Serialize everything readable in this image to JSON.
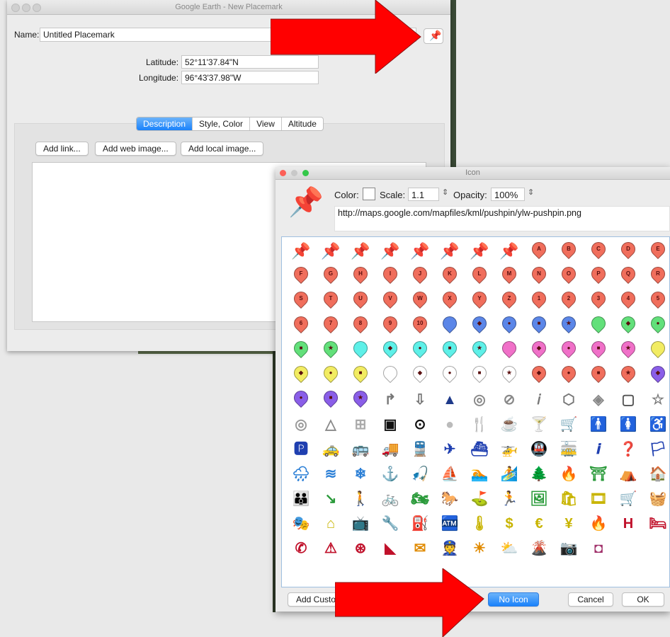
{
  "main_window": {
    "title": "Google Earth - New Placemark",
    "name_label": "Name:",
    "name_value": "Untitled Placemark",
    "latitude_label": "Latitude:",
    "latitude_value": "52°11'37.84\"N",
    "longitude_label": "Longitude:",
    "longitude_value": "96°43'37.98\"W",
    "tabs": [
      "Description",
      "Style, Color",
      "View",
      "Altitude"
    ],
    "add_link": "Add link...",
    "add_web_image": "Add web image...",
    "add_local_image": "Add local image..."
  },
  "icon_window": {
    "title": "Icon",
    "color_label": "Color:",
    "scale_label": "Scale:",
    "scale_value": "1.1",
    "opacity_label": "Opacity:",
    "opacity_value": "100%",
    "url": "http://maps.google.com/mapfiles/kml/pushpin/ylw-pushpin.png",
    "add_custom": "Add Custo",
    "no_icon": "No Icon",
    "cancel": "Cancel",
    "ok": "OK",
    "icons": [
      {
        "k": "tack",
        "c": "#f2e33a"
      },
      {
        "k": "tack",
        "c": "#3c5fd6"
      },
      {
        "k": "tack",
        "c": "#2fc234"
      },
      {
        "k": "tack",
        "c": "#35c6c6"
      },
      {
        "k": "tack",
        "c": "#d438c6"
      },
      {
        "k": "tack",
        "c": "#6b3fd6"
      },
      {
        "k": "tack",
        "c": "#e03a4a"
      },
      {
        "k": "tack",
        "c": "#e9e9e9"
      },
      {
        "k": "pin",
        "c": "#f06e5c",
        "t": "A"
      },
      {
        "k": "pin",
        "c": "#f06e5c",
        "t": "B"
      },
      {
        "k": "pin",
        "c": "#f06e5c",
        "t": "C"
      },
      {
        "k": "pin",
        "c": "#f06e5c",
        "t": "D"
      },
      {
        "k": "pin",
        "c": "#f06e5c",
        "t": "E"
      },
      {
        "k": "pin",
        "c": "#f06e5c",
        "t": "F"
      },
      {
        "k": "pin",
        "c": "#f06e5c",
        "t": "G"
      },
      {
        "k": "pin",
        "c": "#f06e5c",
        "t": "H"
      },
      {
        "k": "pin",
        "c": "#f06e5c",
        "t": "I"
      },
      {
        "k": "pin",
        "c": "#f06e5c",
        "t": "J"
      },
      {
        "k": "pin",
        "c": "#f06e5c",
        "t": "K"
      },
      {
        "k": "pin",
        "c": "#f06e5c",
        "t": "L"
      },
      {
        "k": "pin",
        "c": "#f06e5c",
        "t": "M"
      },
      {
        "k": "pin",
        "c": "#f06e5c",
        "t": "N"
      },
      {
        "k": "pin",
        "c": "#f06e5c",
        "t": "O"
      },
      {
        "k": "pin",
        "c": "#f06e5c",
        "t": "P"
      },
      {
        "k": "pin",
        "c": "#f06e5c",
        "t": "Q"
      },
      {
        "k": "pin",
        "c": "#f06e5c",
        "t": "R"
      },
      {
        "k": "pin",
        "c": "#f06e5c",
        "t": "S"
      },
      {
        "k": "pin",
        "c": "#f06e5c",
        "t": "T"
      },
      {
        "k": "pin",
        "c": "#f06e5c",
        "t": "U"
      },
      {
        "k": "pin",
        "c": "#f06e5c",
        "t": "V"
      },
      {
        "k": "pin",
        "c": "#f06e5c",
        "t": "W"
      },
      {
        "k": "pin",
        "c": "#f06e5c",
        "t": "X"
      },
      {
        "k": "pin",
        "c": "#f06e5c",
        "t": "Y"
      },
      {
        "k": "pin",
        "c": "#f06e5c",
        "t": "Z"
      },
      {
        "k": "pin",
        "c": "#f06e5c",
        "t": "1"
      },
      {
        "k": "pin",
        "c": "#f06e5c",
        "t": "2"
      },
      {
        "k": "pin",
        "c": "#f06e5c",
        "t": "3"
      },
      {
        "k": "pin",
        "c": "#f06e5c",
        "t": "4"
      },
      {
        "k": "pin",
        "c": "#f06e5c",
        "t": "5"
      },
      {
        "k": "pin",
        "c": "#f06e5c",
        "t": "6"
      },
      {
        "k": "pin",
        "c": "#f06e5c",
        "t": "7"
      },
      {
        "k": "pin",
        "c": "#f06e5c",
        "t": "8"
      },
      {
        "k": "pin",
        "c": "#f06e5c",
        "t": "9"
      },
      {
        "k": "pin",
        "c": "#f06e5c",
        "t": "10"
      },
      {
        "k": "pin",
        "c": "#5b86e8",
        "t": ""
      },
      {
        "k": "pin",
        "c": "#5b86e8",
        "t": "◆"
      },
      {
        "k": "pin",
        "c": "#5b86e8",
        "t": "●"
      },
      {
        "k": "pin",
        "c": "#5b86e8",
        "t": "■"
      },
      {
        "k": "pin",
        "c": "#5b86e8",
        "t": "★"
      },
      {
        "k": "pin",
        "c": "#62e07a",
        "t": ""
      },
      {
        "k": "pin",
        "c": "#62e07a",
        "t": "◆"
      },
      {
        "k": "pin",
        "c": "#62e07a",
        "t": "●"
      },
      {
        "k": "pin",
        "c": "#62e07a",
        "t": "■"
      },
      {
        "k": "pin",
        "c": "#62e07a",
        "t": "★"
      },
      {
        "k": "pin",
        "c": "#5ef0e8",
        "t": ""
      },
      {
        "k": "pin",
        "c": "#5ef0e8",
        "t": "◆"
      },
      {
        "k": "pin",
        "c": "#5ef0e8",
        "t": "●"
      },
      {
        "k": "pin",
        "c": "#5ef0e8",
        "t": "■"
      },
      {
        "k": "pin",
        "c": "#5ef0e8",
        "t": "★"
      },
      {
        "k": "pin",
        "c": "#f070c8",
        "t": ""
      },
      {
        "k": "pin",
        "c": "#f070c8",
        "t": "◆"
      },
      {
        "k": "pin",
        "c": "#f070c8",
        "t": "●"
      },
      {
        "k": "pin",
        "c": "#f070c8",
        "t": "■"
      },
      {
        "k": "pin",
        "c": "#f070c8",
        "t": "★"
      },
      {
        "k": "pin",
        "c": "#f2ec62",
        "t": ""
      },
      {
        "k": "pin",
        "c": "#f2ec62",
        "t": "◆"
      },
      {
        "k": "pin",
        "c": "#f2ec62",
        "t": "●"
      },
      {
        "k": "pin",
        "c": "#f2ec62",
        "t": "■"
      },
      {
        "k": "pin",
        "c": "#ffffff",
        "t": ""
      },
      {
        "k": "pin",
        "c": "#ffffff",
        "t": "◆"
      },
      {
        "k": "pin",
        "c": "#ffffff",
        "t": "●"
      },
      {
        "k": "pin",
        "c": "#ffffff",
        "t": "■"
      },
      {
        "k": "pin",
        "c": "#ffffff",
        "t": "★"
      },
      {
        "k": "pin",
        "c": "#f06e5c",
        "t": "◆"
      },
      {
        "k": "pin",
        "c": "#f06e5c",
        "t": "●"
      },
      {
        "k": "pin",
        "c": "#f06e5c",
        "t": "■"
      },
      {
        "k": "pin",
        "c": "#f06e5c",
        "t": "★"
      },
      {
        "k": "pin",
        "c": "#8a5ee8",
        "t": "◆"
      },
      {
        "k": "pin",
        "c": "#8a5ee8",
        "t": "●"
      },
      {
        "k": "pin",
        "c": "#8a5ee8",
        "t": "■"
      },
      {
        "k": "pin",
        "c": "#8a5ee8",
        "t": "★"
      },
      {
        "k": "sym",
        "g": "↱",
        "c": "#777"
      },
      {
        "k": "sym",
        "g": "⇩",
        "c": "#777"
      },
      {
        "k": "sym",
        "g": "▲",
        "c": "#1e3a8a"
      },
      {
        "k": "sym",
        "g": "◎",
        "c": "#888"
      },
      {
        "k": "sym",
        "g": "⊘",
        "c": "#888"
      },
      {
        "k": "sym",
        "g": "𝑖",
        "c": "#777"
      },
      {
        "k": "sym",
        "g": "⬡",
        "c": "#777"
      },
      {
        "k": "sym",
        "g": "◈",
        "c": "#888"
      },
      {
        "k": "sym",
        "g": "▢",
        "c": "#555"
      },
      {
        "k": "sym",
        "g": "☆",
        "c": "#777"
      },
      {
        "k": "sym",
        "g": "◎",
        "c": "#999"
      },
      {
        "k": "sym",
        "g": "△",
        "c": "#888"
      },
      {
        "k": "sym",
        "g": "⊞",
        "c": "#aaa"
      },
      {
        "k": "sym",
        "g": "▣",
        "c": "#111"
      },
      {
        "k": "sym",
        "g": "⊙",
        "c": "#111"
      },
      {
        "k": "sym",
        "g": "●",
        "c": "#bbb"
      },
      {
        "k": "sym",
        "g": "🍴",
        "c": "#222"
      },
      {
        "k": "sym",
        "g": "☕",
        "c": "#333"
      },
      {
        "k": "sym",
        "g": "🍸",
        "c": "#333"
      },
      {
        "k": "sym",
        "g": "🛒",
        "c": "#333"
      },
      {
        "k": "sym",
        "g": "🚹",
        "c": "#333"
      },
      {
        "k": "sym",
        "g": "🚺",
        "c": "#333"
      },
      {
        "k": "sym",
        "g": "♿",
        "c": "#222"
      },
      {
        "k": "sym",
        "g": "🅿",
        "c": "#1f3fb0"
      },
      {
        "k": "sym",
        "g": "🚕",
        "c": "#1f3fb0"
      },
      {
        "k": "sym",
        "g": "🚌",
        "c": "#1f3fb0"
      },
      {
        "k": "sym",
        "g": "🚚",
        "c": "#1f3fb0"
      },
      {
        "k": "sym",
        "g": "🚆",
        "c": "#1f3fb0"
      },
      {
        "k": "sym",
        "g": "✈",
        "c": "#1f3fb0"
      },
      {
        "k": "sym",
        "g": "⛴",
        "c": "#1f3fb0"
      },
      {
        "k": "sym",
        "g": "🚁",
        "c": "#1f3fb0"
      },
      {
        "k": "sym",
        "g": "🚇",
        "c": "#1f3fb0"
      },
      {
        "k": "sym",
        "g": "🚋",
        "c": "#1f3fb0"
      },
      {
        "k": "sym",
        "g": "𝒊",
        "c": "#1f3fb0"
      },
      {
        "k": "sym",
        "g": "❓",
        "c": "#1f3fb0"
      },
      {
        "k": "sym",
        "g": "🏳",
        "c": "#1f3fb0"
      },
      {
        "k": "sym",
        "g": "🌧",
        "c": "#2b7fd6"
      },
      {
        "k": "sym",
        "g": "≋",
        "c": "#2b7fd6"
      },
      {
        "k": "sym",
        "g": "❄",
        "c": "#2b7fd6"
      },
      {
        "k": "sym",
        "g": "⚓",
        "c": "#2b7fd6"
      },
      {
        "k": "sym",
        "g": "🎣",
        "c": "#2b7fd6"
      },
      {
        "k": "sym",
        "g": "⛵",
        "c": "#2b7fd6"
      },
      {
        "k": "sym",
        "g": "🏊",
        "c": "#2b7fd6"
      },
      {
        "k": "sym",
        "g": "🏄",
        "c": "#2b7fd6"
      },
      {
        "k": "sym",
        "g": "🌲",
        "c": "#2a9a3a"
      },
      {
        "k": "sym",
        "g": "🔥",
        "c": "#2a9a3a"
      },
      {
        "k": "sym",
        "g": "⛩",
        "c": "#2a9a3a"
      },
      {
        "k": "sym",
        "g": "⛺",
        "c": "#2a9a3a"
      },
      {
        "k": "sym",
        "g": "🏠",
        "c": "#2a9a3a"
      },
      {
        "k": "sym",
        "g": "👪",
        "c": "#2a9a3a"
      },
      {
        "k": "sym",
        "g": "↘",
        "c": "#2a9a3a"
      },
      {
        "k": "sym",
        "g": "🚶",
        "c": "#2a9a3a"
      },
      {
        "k": "sym",
        "g": "🚲",
        "c": "#2a9a3a"
      },
      {
        "k": "sym",
        "g": "🏍",
        "c": "#2a9a3a"
      },
      {
        "k": "sym",
        "g": "🐎",
        "c": "#2a9a3a"
      },
      {
        "k": "sym",
        "g": "⛳",
        "c": "#2a9a3a"
      },
      {
        "k": "sym",
        "g": "🏃",
        "c": "#2a9a3a"
      },
      {
        "k": "sym",
        "g": "🖼",
        "c": "#2a9a3a"
      },
      {
        "k": "sym",
        "g": "🛍",
        "c": "#c8b400"
      },
      {
        "k": "sym",
        "g": "🎞",
        "c": "#c8b400"
      },
      {
        "k": "sym",
        "g": "🛒",
        "c": "#c8b400"
      },
      {
        "k": "sym",
        "g": "🧺",
        "c": "#c8b400"
      },
      {
        "k": "sym",
        "g": "🎭",
        "c": "#c8b400"
      },
      {
        "k": "sym",
        "g": "⌂",
        "c": "#c8b400"
      },
      {
        "k": "sym",
        "g": "📺",
        "c": "#c8b400"
      },
      {
        "k": "sym",
        "g": "🔧",
        "c": "#c8b400"
      },
      {
        "k": "sym",
        "g": "⛽",
        "c": "#c8b400"
      },
      {
        "k": "sym",
        "g": "🏧",
        "c": "#c8b400"
      },
      {
        "k": "sym",
        "g": "🌡",
        "c": "#c8b400"
      },
      {
        "k": "sym",
        "g": "$",
        "c": "#c8b400"
      },
      {
        "k": "sym",
        "g": "€",
        "c": "#c8b400"
      },
      {
        "k": "sym",
        "g": "¥",
        "c": "#c8b400"
      },
      {
        "k": "sym",
        "g": "🔥",
        "c": "#c0102a"
      },
      {
        "k": "sym",
        "g": "H",
        "c": "#c0102a"
      },
      {
        "k": "sym",
        "g": "🛏",
        "c": "#c0102a"
      },
      {
        "k": "sym",
        "g": "✆",
        "c": "#c0102a"
      },
      {
        "k": "sym",
        "g": "⚠",
        "c": "#c0102a"
      },
      {
        "k": "sym",
        "g": "⊛",
        "c": "#c0102a"
      },
      {
        "k": "sym",
        "g": "◣",
        "c": "#c0102a"
      },
      {
        "k": "sym",
        "g": "✉",
        "c": "#e08a00"
      },
      {
        "k": "sym",
        "g": "👮",
        "c": "#e08a00"
      },
      {
        "k": "sym",
        "g": "☀",
        "c": "#e08a00"
      },
      {
        "k": "sym",
        "g": "⛅",
        "c": "#e08a00"
      },
      {
        "k": "sym",
        "g": "🌋",
        "c": "#e08a00"
      },
      {
        "k": "sym",
        "g": "📷",
        "c": "#a0306a"
      },
      {
        "k": "sym",
        "g": "◘",
        "c": "#a0306a"
      }
    ]
  },
  "colors": {
    "accent_blue": "#1a82fb",
    "arrow_red": "#ff0000"
  }
}
